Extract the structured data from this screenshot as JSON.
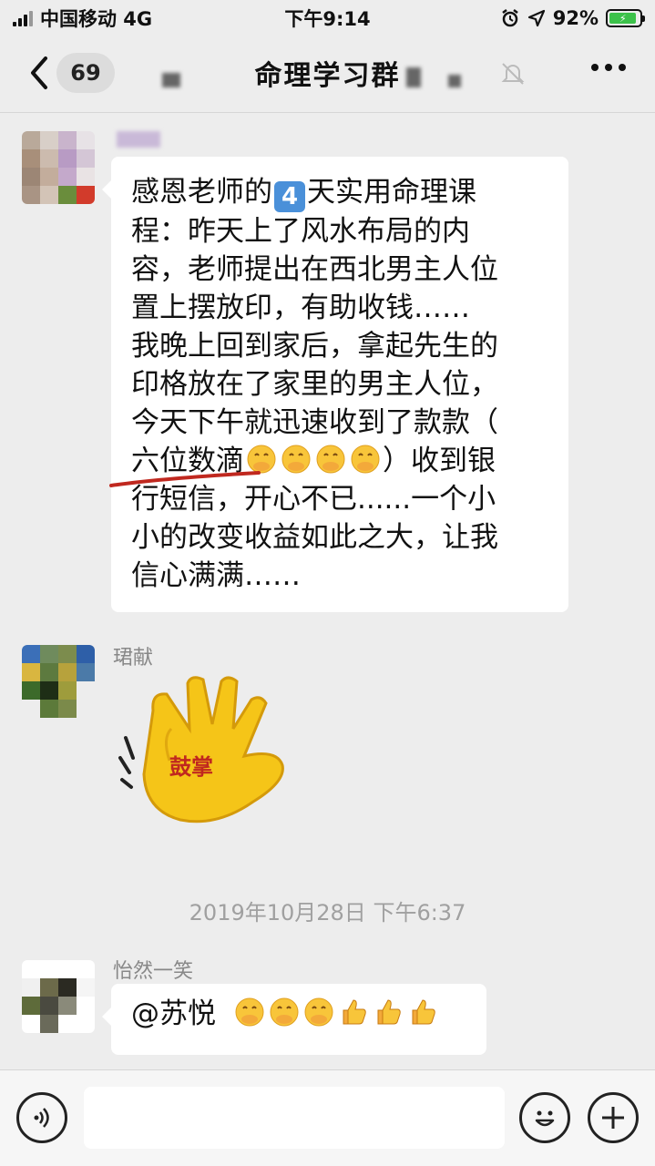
{
  "status_bar": {
    "carrier": "中国移动 4G",
    "time": "下午9:14",
    "battery": "92%",
    "battery_level": 0.92
  },
  "nav": {
    "back_count": "69",
    "title": "命理学习群"
  },
  "messages": [
    {
      "sender": "",
      "lines": [
        [
          "感恩老师的",
          "4",
          "天实用命理课"
        ],
        "程：昨天上了风水布局的内",
        "容，老师提出在西北男主人位",
        "置上摆放印，有助收钱……",
        "我晚上回到家后，拿起先生的",
        "印格放在了家里的男主人位，",
        "今天下午就迅速收到了款款（",
        [
          "六位数滴",
          "）收到银"
        ],
        "行短信，开心不已......一个小",
        "小的改变收益如此之大，让我",
        "信心满满……"
      ]
    },
    {
      "sender": "珺献",
      "sticker_text": "鼓掌"
    },
    {
      "divider": "2019年10月28日 下午6:37"
    },
    {
      "sender": "怡然一笑",
      "text": "@苏悦"
    }
  ],
  "icons": {
    "face_emoji": "face-with-hand-over-mouth-icon",
    "thumb_emoji": "thumbs-up-icon"
  },
  "colors": {
    "accent_green": "#3cc24a",
    "bubble": "#ffffff",
    "background": "#ededed",
    "underline": "#c0281f",
    "sticker_yellow": "#f5c518"
  }
}
